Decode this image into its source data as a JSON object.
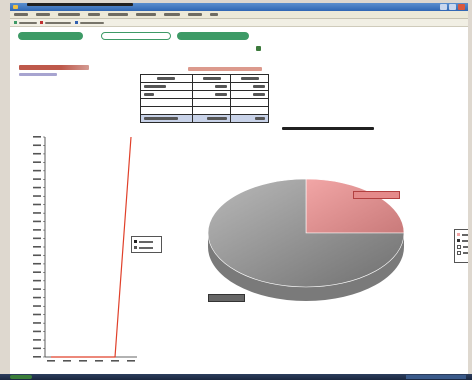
{
  "window": {
    "title": ""
  },
  "menubar": {
    "items": [
      "",
      "",
      "",
      "",
      "",
      "",
      "",
      "",
      ""
    ]
  },
  "toolbar": {
    "items": [
      "",
      "",
      ""
    ]
  },
  "nav": {
    "buttons": [
      {
        "label": ""
      },
      {
        "label": ""
      },
      {
        "label": ""
      }
    ]
  },
  "filter": {
    "date": ""
  },
  "summary": {
    "total_label": "",
    "subtitle": "",
    "table_link": "",
    "table": {
      "headers": [
        "",
        "",
        ""
      ],
      "rows": [
        [
          "",
          "",
          ""
        ],
        [
          "",
          "",
          ""
        ],
        [
          "",
          "",
          ""
        ],
        [
          "",
          "",
          ""
        ]
      ],
      "footer": [
        "",
        "",
        ""
      ]
    }
  },
  "colors": {
    "accent": "#3d9a66",
    "line_series": "#e0402a",
    "pie_slice_a": "#f2a6a6",
    "pie_slice_b": "#b9b9b9"
  },
  "chart_data": [
    {
      "type": "line",
      "title": "",
      "x": [
        "",
        "",
        "",
        "",
        "",
        ""
      ],
      "series": [
        {
          "values": [
            0,
            0,
            0,
            0,
            0,
            1000
          ]
        }
      ],
      "ylim": [
        0,
        1000
      ],
      "legend_entries": [
        "",
        ""
      ],
      "legend": "right",
      "grid": false
    },
    {
      "type": "pie",
      "title": "",
      "labels": [
        "",
        ""
      ],
      "values": [
        25,
        75
      ],
      "legend": "right"
    }
  ]
}
